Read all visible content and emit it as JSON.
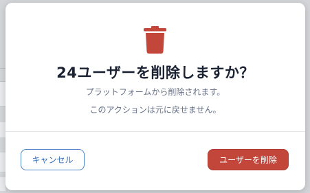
{
  "dialog": {
    "title": "24ユーザーを削除しますか？",
    "message_line1": "プラットフォームから削除されます。",
    "message_line2": "このアクションは元に戻せません。",
    "icon": "trash-icon",
    "cancel_label": "キャンセル",
    "confirm_label": "ユーザーを削除"
  },
  "colors": {
    "danger": "#c2463a",
    "primary_outline": "#4a82c4",
    "title_text": "#1b2333",
    "body_text": "#667085"
  }
}
